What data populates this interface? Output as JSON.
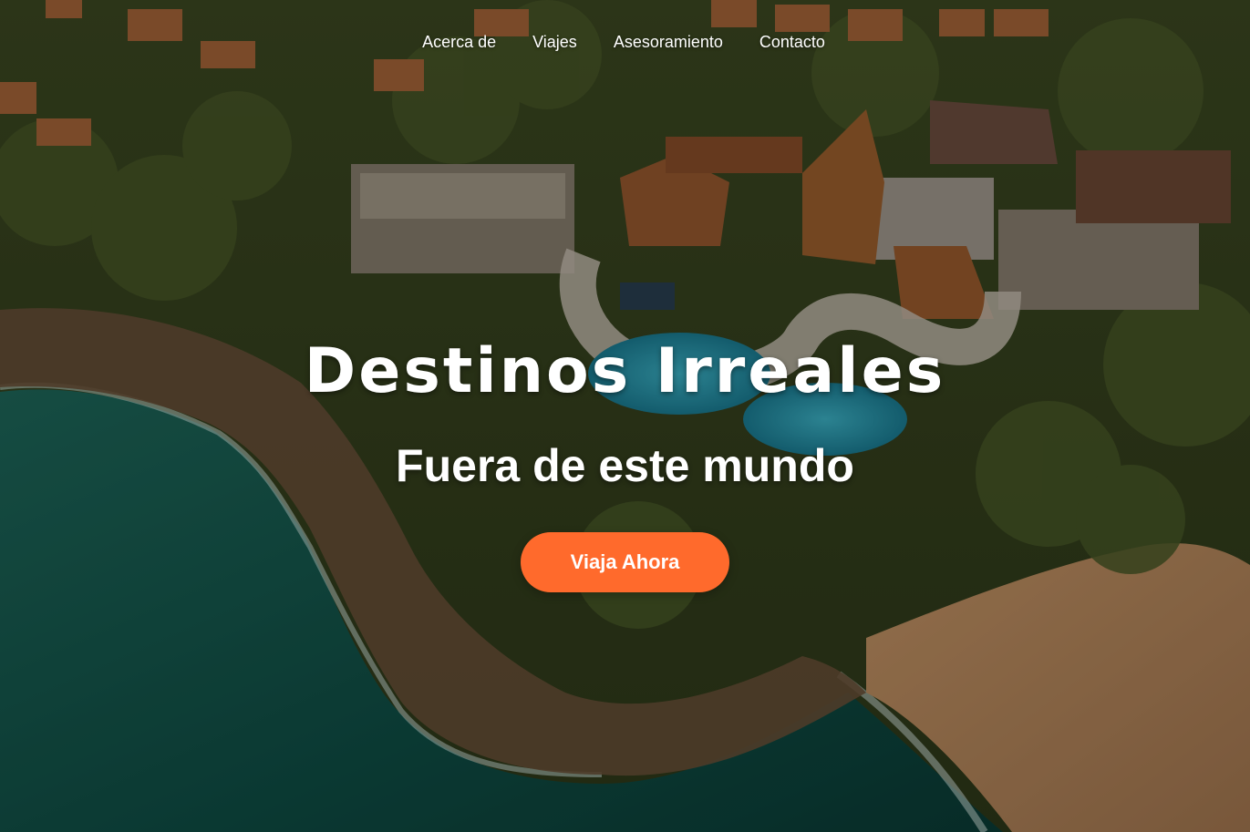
{
  "nav": {
    "items": [
      {
        "label": "Acerca de"
      },
      {
        "label": "Viajes"
      },
      {
        "label": "Asesoramiento"
      },
      {
        "label": "Contacto"
      }
    ]
  },
  "hero": {
    "title": "Destinos Irreales",
    "subtitle": "Fuera de este mundo",
    "cta_label": "Viaja Ahora",
    "cta_color": "#ff6a2c"
  }
}
